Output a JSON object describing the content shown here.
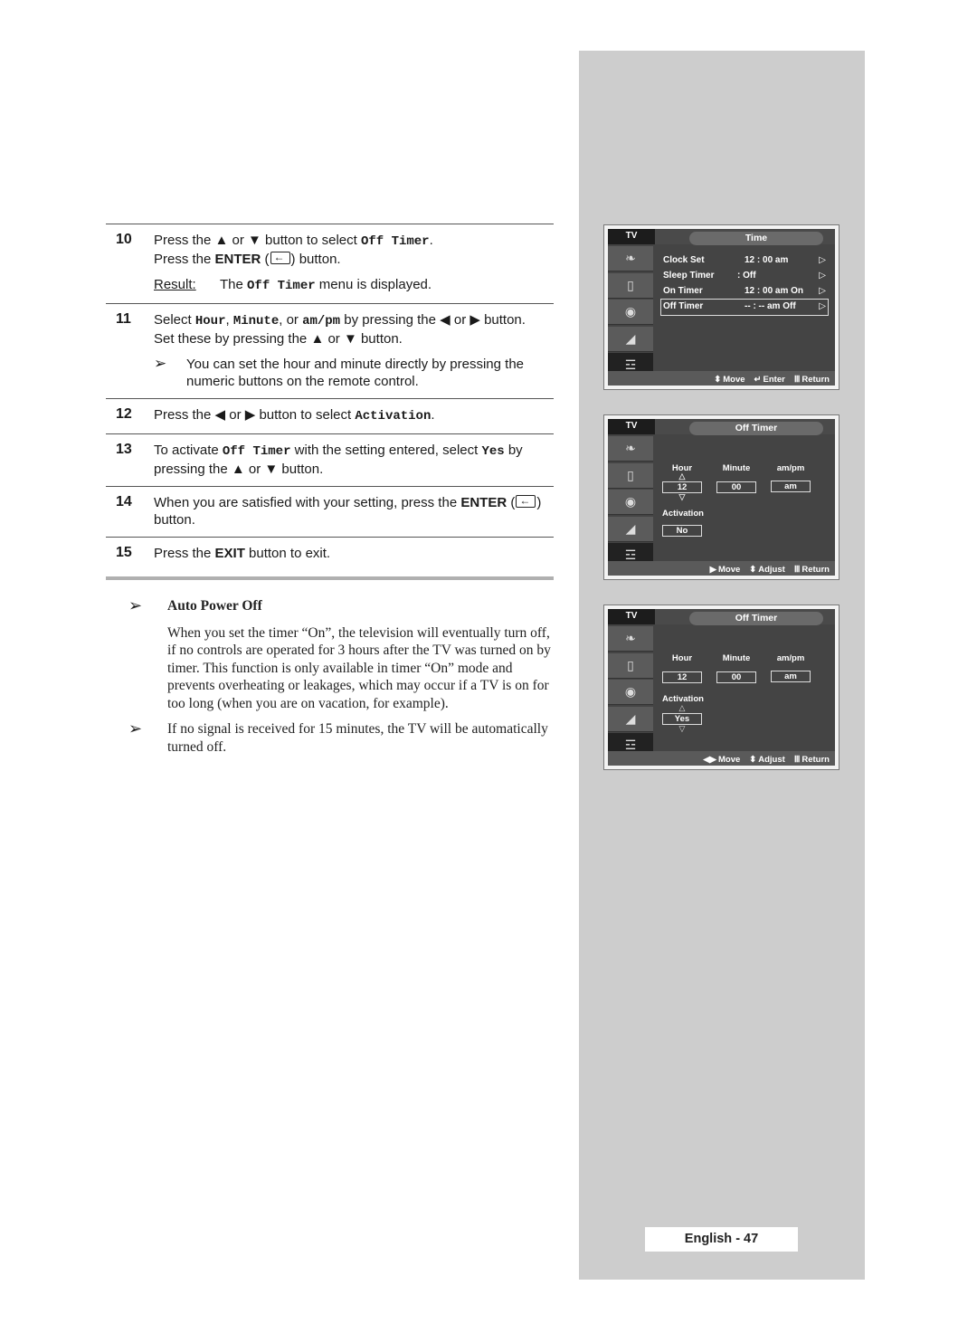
{
  "steps": [
    {
      "num": "10",
      "line1": {
        "a": "Press the ▲ or ▼ button to select ",
        "code": "Off Timer",
        "b": "."
      },
      "line2": {
        "a": "Press the ",
        "bold": "ENTER",
        "b": " (",
        "c": ") button."
      },
      "result": {
        "label": "Result:",
        "a": "The ",
        "code": "Off Timer",
        "b": " menu is displayed."
      }
    },
    {
      "num": "11",
      "line1": {
        "a": "Select ",
        "code1": "Hour",
        "sep1": ", ",
        "code2": "Minute",
        "sep2": ", or ",
        "code3": "am/pm",
        "b": " by pressing the ◀ or ▶ button."
      },
      "line2": "Set these by pressing the ▲ or ▼ button.",
      "note": "You can set the hour and minute directly by pressing the numeric buttons on the remote control."
    },
    {
      "num": "12",
      "line1": {
        "a": "Press the ◀ or ▶ button to select ",
        "code": "Activation",
        "b": "."
      }
    },
    {
      "num": "13",
      "line1": {
        "a": "To activate ",
        "code1": "Off Timer",
        "mid": " with the setting entered, select ",
        "code2": "Yes",
        "b": " by pressing the ▲ or ▼ button."
      }
    },
    {
      "num": "14",
      "line1": {
        "a": "When you are satisfied with your setting, press the ",
        "bold": "ENTER",
        "b": " (",
        "c": ") button."
      }
    },
    {
      "num": "15",
      "line1": {
        "a": "Press the ",
        "bold": "EXIT",
        "b": " button to exit."
      }
    }
  ],
  "auto_power_off": {
    "title": "Auto Power Off",
    "body": "When you set the timer “On”, the television will eventually turn off, if no controls are operated for 3 hours after the TV was turned on by timer. This function is only available in timer “On” mode and prevents overheating or leakages, which may occur if a TV is on for too long (when you are on vacation, for example).",
    "note": "If no signal is received for 15 minutes, the TV will be automatically turned off."
  },
  "arrow_glyph": "➢",
  "screens": {
    "time_menu": {
      "tab": "TV",
      "title": "Time",
      "rows": [
        {
          "label": "Clock Set",
          "value": "12 : 00 am",
          "arrow": "▷"
        },
        {
          "label": "Sleep Timer",
          "value": ": Off",
          "arrow": "▷"
        },
        {
          "label": "On Timer",
          "value": "12 : 00 am On",
          "arrow": "▷"
        },
        {
          "label": "Off Timer",
          "value": "-- : -- am Off",
          "arrow": "▷",
          "selected": true
        }
      ],
      "footer": {
        "move": "Move",
        "enter": "Enter",
        "return": "Return"
      }
    },
    "off_timer_1": {
      "tab": "TV",
      "title": "Off Timer",
      "hour_label": "Hour",
      "minute_label": "Minute",
      "ampm_label": "am/pm",
      "hour": "12",
      "minute": "00",
      "ampm": "am",
      "activation_label": "Activation",
      "activation": "No",
      "footer": {
        "move": "Move",
        "adjust": "Adjust",
        "return": "Return"
      }
    },
    "off_timer_2": {
      "tab": "TV",
      "title": "Off Timer",
      "hour_label": "Hour",
      "minute_label": "Minute",
      "ampm_label": "am/pm",
      "hour": "12",
      "minute": "00",
      "ampm": "am",
      "activation_label": "Activation",
      "activation": "Yes",
      "footer": {
        "move": "Move",
        "adjust": "Adjust",
        "return": "Return"
      }
    }
  },
  "footer": {
    "page_label": "English - 47"
  }
}
